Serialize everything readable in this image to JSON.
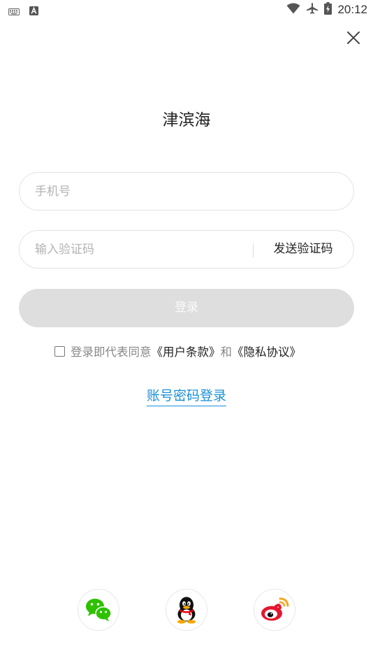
{
  "status_bar": {
    "time": "20:12",
    "icons": [
      "keyboard-icon",
      "a-icon",
      "wifi-icon",
      "airplane-icon",
      "battery-icon"
    ]
  },
  "header": {
    "close_icon": "close-icon"
  },
  "title": "津滨海",
  "phone_field": {
    "placeholder": "手机号",
    "value": ""
  },
  "code_field": {
    "placeholder": "输入验证码",
    "value": "",
    "send_label": "发送验证码"
  },
  "login_button": {
    "label": "登录"
  },
  "agreement": {
    "prefix": "登录即代表同意",
    "terms": "《用户条款》",
    "and": "和",
    "privacy": "《隐私协议》",
    "checked": false
  },
  "password_login": {
    "label": "账号密码登录"
  },
  "social": {
    "icons": [
      "wechat-icon",
      "qq-icon",
      "weibo-icon"
    ]
  },
  "colors": {
    "link": "#1a8fd6",
    "wechat": "#2dc100",
    "weibo": "#e6162d",
    "weibo_wave": "#f5a623",
    "login_disabled": "#dedede"
  }
}
